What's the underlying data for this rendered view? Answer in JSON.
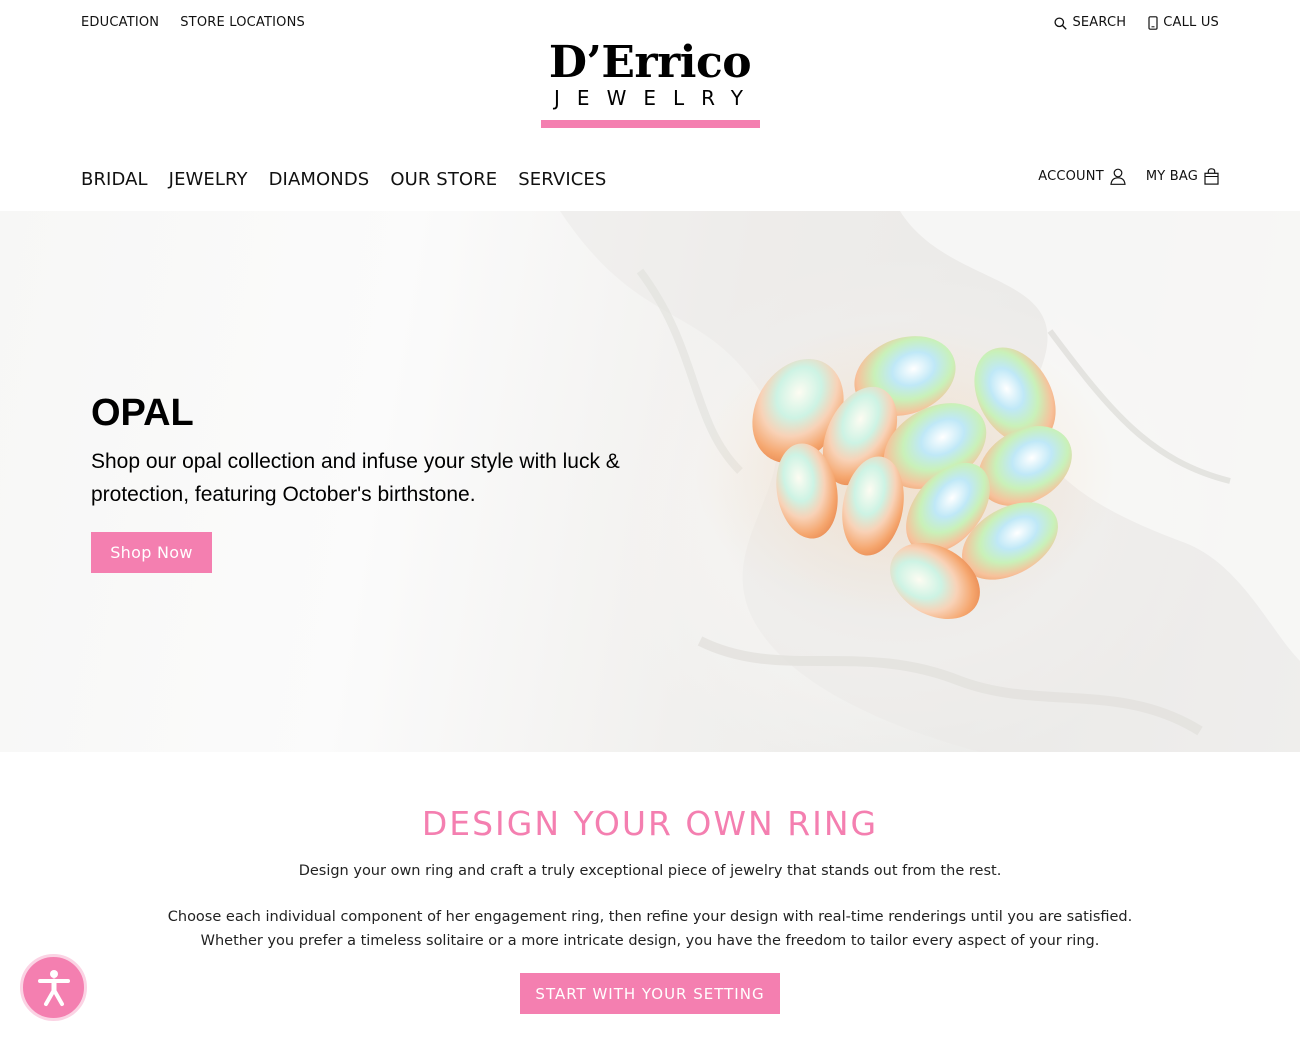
{
  "utility_nav": {
    "left": [
      "EDUCATION",
      "STORE LOCATIONS"
    ],
    "search_label": "SEARCH",
    "call_label": "CALL US"
  },
  "logo": {
    "name": "D’Errico",
    "subtitle": "JEWELRY"
  },
  "main_nav": {
    "items": [
      "BRIDAL",
      "JEWELRY",
      "DIAMONDS",
      "OUR STORE",
      "SERVICES"
    ],
    "account_label": "ACCOUNT",
    "bag_label": "MY BAG"
  },
  "hero": {
    "title": "OPAL",
    "text": "Shop our opal collection and infuse your style with luck & protection, featuring October's birthstone.",
    "button_label": "Shop Now"
  },
  "design_section": {
    "title": "DESIGN YOUR OWN RING",
    "paragraph_1": "Design your own ring and craft a truly exceptional piece of jewelry that stands out from the rest.",
    "paragraph_2": "Choose each individual component of her engagement ring, then refine your design with real-time renderings until you are satisfied. Whether you prefer a timeless solitaire or a more intricate design, you have the freedom to tailor every aspect of your ring.",
    "button_label": "START WITH YOUR SETTING"
  },
  "colors": {
    "accent": "#f47fb0",
    "text": "#111111",
    "background": "#ffffff"
  },
  "icons": [
    "search-icon",
    "phone-icon",
    "user-icon",
    "shopping-bag-icon",
    "accessibility-icon"
  ]
}
